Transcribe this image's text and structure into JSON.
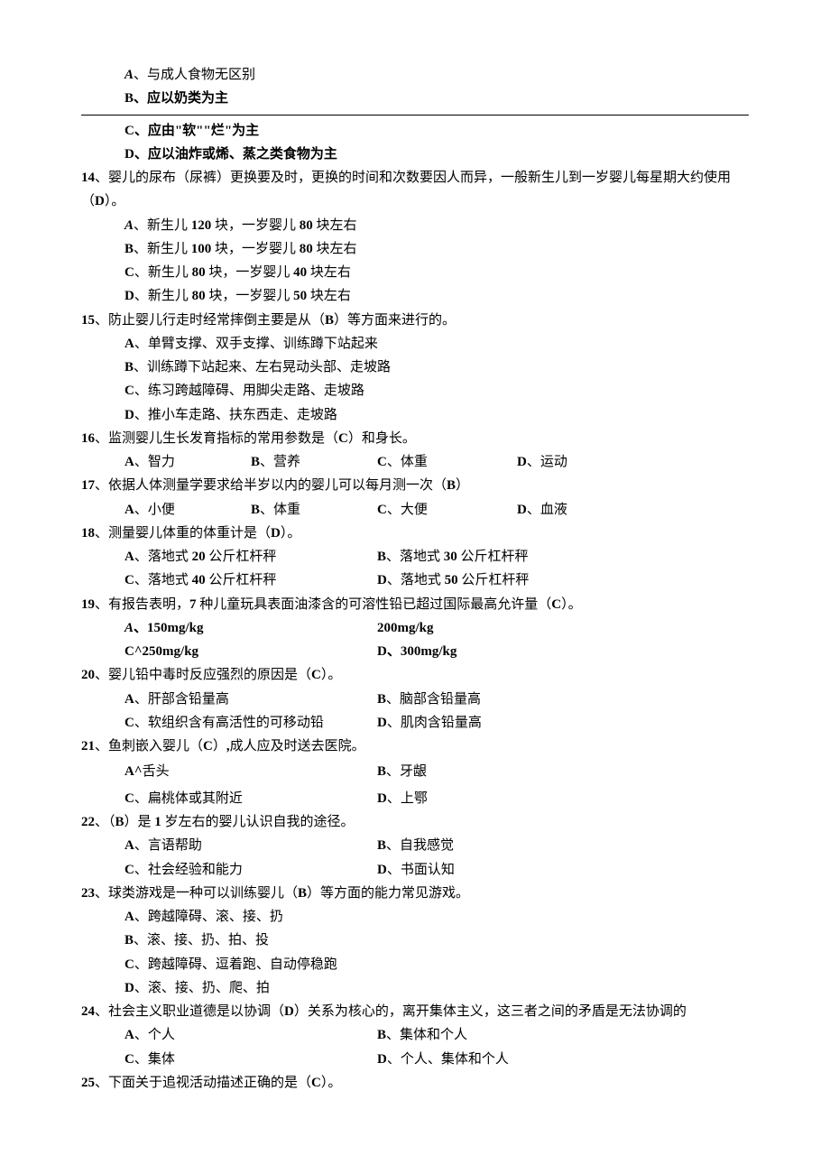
{
  "q13": {
    "a": "A、与成人食物无区别",
    "b": "B、应以奶类为主",
    "c": "C、应由\"软\"\"烂\"为主",
    "d": "D、应以油炸或烯、蒸之类食物为主"
  },
  "q14": {
    "stem": "14、婴儿的尿布（尿裤）更换要及时，更换的时间和次数要因人而异，一般新生儿到一岁婴儿每星期大约使用（D）。",
    "a": "A、新生儿 120 块，一岁婴儿 80 块左右",
    "b": "B、新生儿 100 块，一岁婴儿 80 块左右",
    "c": "C、新生儿 80 块，一岁婴儿 40 块左右",
    "d": "D、新生儿 80 块，一岁婴儿 50 块左右"
  },
  "q15": {
    "stem": "15、防止婴儿行走时经常摔倒主要是从（B）等方面来进行的。",
    "a": "A、单臂支撑、双手支撑、训练蹲下站起来",
    "b": "B、训练蹲下站起来、左右晃动头部、走坡路",
    "c": "C、练习跨越障碍、用脚尖走路、走坡路",
    "d": "D、推小车走路、扶东西走、走坡路"
  },
  "q16": {
    "stem": "16、监测婴儿生长发育指标的常用参数是（C）和身长。",
    "a": "A、智力",
    "b": "B、营养",
    "c": "C、体重",
    "d": "D、运动"
  },
  "q17": {
    "stem": "17、依据人体测量学要求给半岁以内的婴儿可以每月测一次（B）",
    "a": "A、小便",
    "b": "B、体重",
    "c": "C、大便",
    "d": "D、血液"
  },
  "q18": {
    "stem": "18、测量婴儿体重的体重计是（D）。",
    "a": "A、落地式 20 公斤杠杆秤",
    "b": "B、落地式 30 公斤杠杆秤",
    "c": "C、落地式 40 公斤杠杆秤",
    "d": "D、落地式 50 公斤杠杆秤"
  },
  "q19": {
    "stem": "19、有报告表明，7 种儿童玩具表面油漆含的可溶性铅已超过国际最高允许量（C）。",
    "a": "A、150mg/kg",
    "b": "200mg/kg",
    "c": "C^250mg/kg",
    "d": "D、300mg/kg"
  },
  "q20": {
    "stem": "20、婴儿铅中毒时反应强烈的原因是（C）。",
    "a": "A、肝部含铅量高",
    "b": "B、脑部含铅量高",
    "c": "C、软组织含有高活性的可移动铅",
    "d": "D、肌肉含铅量高"
  },
  "q21": {
    "stem": "21、鱼刺嵌入婴儿（C）,成人应及时送去医院。",
    "a": "A^舌头",
    "b": "B、牙龈",
    "c": "C、扁桃体或其附近",
    "d": "D、上鄂"
  },
  "q22": {
    "stem": "22、（B）是 1 岁左右的婴儿认识自我的途径。",
    "a": "A、言语帮助",
    "b": "B、自我感觉",
    "c": "C、社会经验和能力",
    "d": "D、书面认知"
  },
  "q23": {
    "stem": "23、球类游戏是一种可以训练婴儿（B）等方面的能力常见游戏。",
    "a": "A、跨越障碍、滚、接、扔",
    "b": "B、滚、接、扔、拍、投",
    "c": "C、跨越障碍、逗着跑、自动停稳跑",
    "d": "D、滚、接、扔、爬、拍"
  },
  "q24": {
    "stem": "24、社会主义职业道德是以协调（D）关系为核心的，离开集体主义，这三者之间的矛盾是无法协调的",
    "a": "A、个人",
    "b": "B、集体和个人",
    "c": "C、集体",
    "d": "D、个人、集体和个人"
  },
  "q25": {
    "stem": "25、下面关于追视活动描述正确的是（C）。"
  }
}
